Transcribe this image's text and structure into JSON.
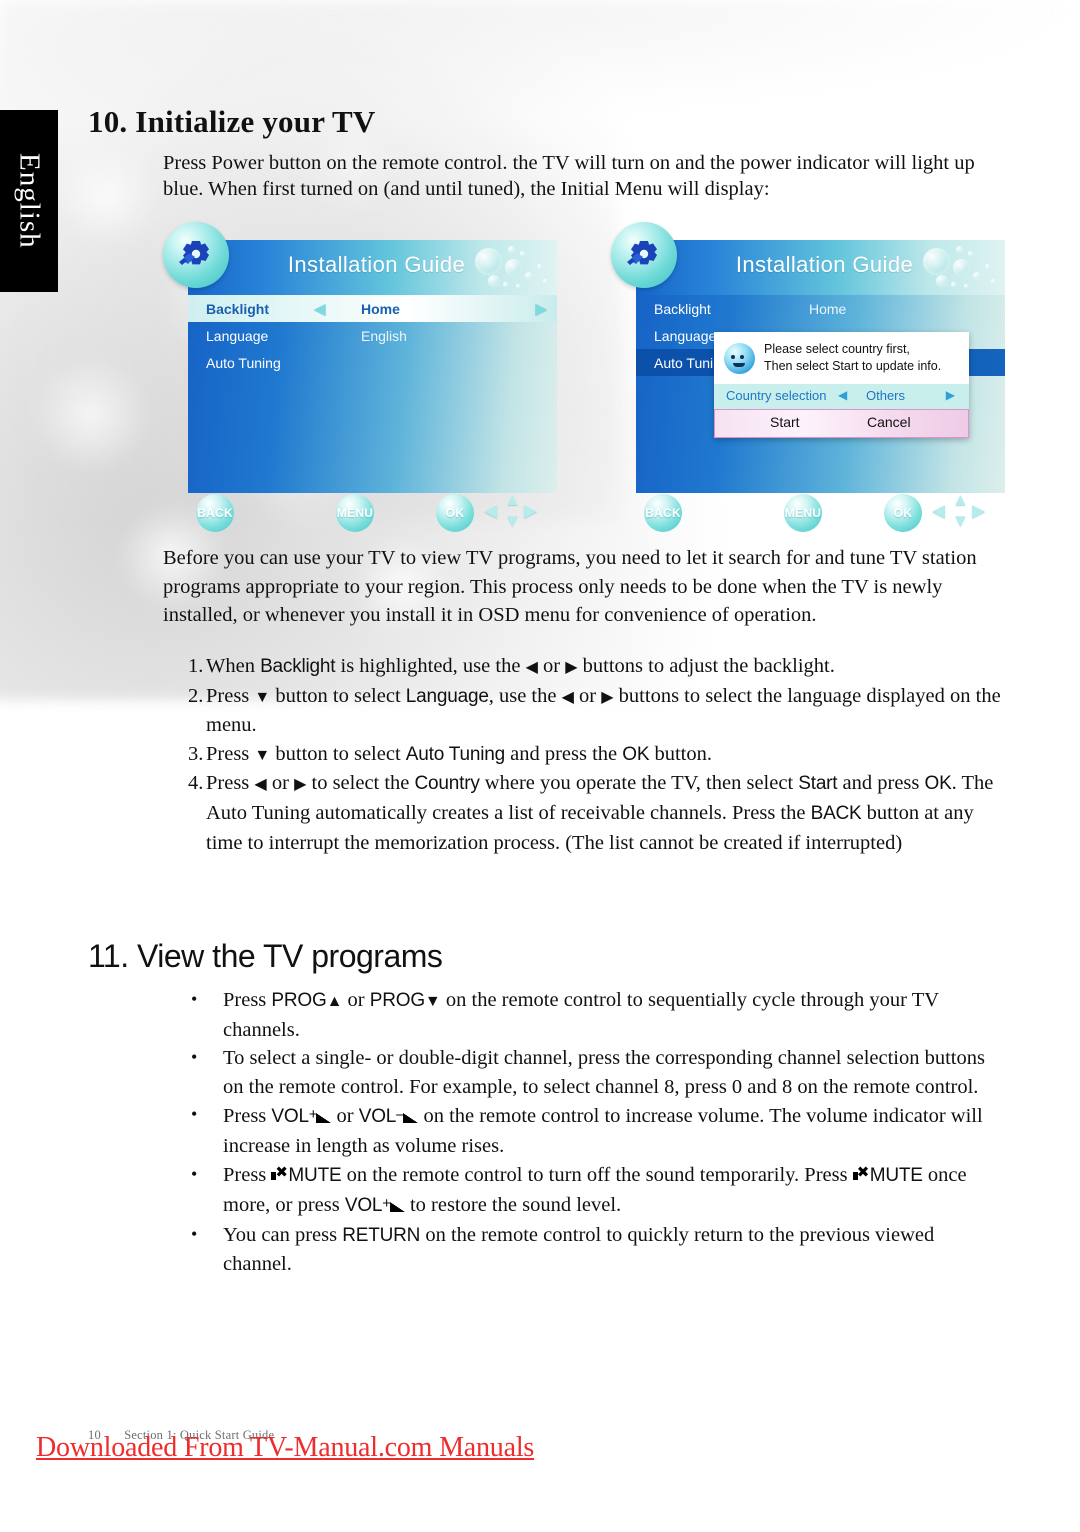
{
  "page": {
    "language_tab": "English",
    "background_note": "soft grey bokeh texture"
  },
  "section10": {
    "heading": "10. Initialize your TV",
    "intro": "Press Power button on the remote control. the TV will turn on and the power indicator will light up blue. When first turned on (and until tuned), the Initial Menu will display:",
    "paragraph": "Before you can use your TV to view TV programs, you need to let it search for and tune TV station programs appropriate to your region. This process only needs to be done when the TV is newly installed, or whenever you install it in OSD menu for convenience of operation.",
    "steps": [
      {
        "number": "1.",
        "parts": [
          {
            "t": "text",
            "v": "When "
          },
          {
            "t": "ui",
            "v": "Backlight"
          },
          {
            "t": "text",
            "v": " is highlighted, use the "
          },
          {
            "t": "glyph",
            "v": "◀"
          },
          {
            "t": "text",
            "v": " or "
          },
          {
            "t": "glyph",
            "v": "▶"
          },
          {
            "t": "text",
            "v": " buttons to adjust the backlight."
          }
        ]
      },
      {
        "number": "2.",
        "parts": [
          {
            "t": "text",
            "v": "Press "
          },
          {
            "t": "glyph",
            "v": "▼"
          },
          {
            "t": "text",
            "v": " button to select "
          },
          {
            "t": "ui",
            "v": "Language"
          },
          {
            "t": "text",
            "v": ", use the "
          },
          {
            "t": "glyph",
            "v": "◀"
          },
          {
            "t": "text",
            "v": " or "
          },
          {
            "t": "glyph",
            "v": "▶"
          },
          {
            "t": "text",
            "v": " buttons to select the language displayed on the menu."
          }
        ]
      },
      {
        "number": "3.",
        "parts": [
          {
            "t": "text",
            "v": "Press "
          },
          {
            "t": "glyph",
            "v": "▼"
          },
          {
            "t": "text",
            "v": " button to select "
          },
          {
            "t": "ui",
            "v": "Auto Tuning"
          },
          {
            "t": "text",
            "v": " and press the "
          },
          {
            "t": "ui",
            "v": "OK"
          },
          {
            "t": "text",
            "v": " button."
          }
        ]
      },
      {
        "number": "4.",
        "parts": [
          {
            "t": "text",
            "v": "Press "
          },
          {
            "t": "glyph",
            "v": "◀"
          },
          {
            "t": "text",
            "v": " or "
          },
          {
            "t": "glyph",
            "v": "▶"
          },
          {
            "t": "text",
            "v": " to select the "
          },
          {
            "t": "ui",
            "v": "Country"
          },
          {
            "t": "text",
            "v": " where you operate the TV, then select "
          },
          {
            "t": "ui",
            "v": "Start"
          },
          {
            "t": "text",
            "v": " and press "
          },
          {
            "t": "ui",
            "v": "OK"
          },
          {
            "t": "text",
            "v": ". The Auto Tuning automatically creates a list of receivable channels. Press the "
          },
          {
            "t": "ui",
            "v": "BACK"
          },
          {
            "t": "text",
            "v": " button at any time to interrupt the memorization process. (The list cannot be created if interrupted)"
          }
        ]
      }
    ]
  },
  "section11": {
    "heading": "11. View the TV programs",
    "bullets": [
      {
        "parts": [
          {
            "t": "text",
            "v": "Press "
          },
          {
            "t": "ui",
            "v": "PROG"
          },
          {
            "t": "glyph",
            "v": "▲"
          },
          {
            "t": "text",
            "v": " or "
          },
          {
            "t": "ui",
            "v": "PROG"
          },
          {
            "t": "glyph",
            "v": "▼"
          },
          {
            "t": "text",
            "v": " on the remote control to sequentially cycle through your TV channels."
          }
        ]
      },
      {
        "parts": [
          {
            "t": "text",
            "v": "To select a single- or double-digit channel, press the corresponding channel selection buttons on the remote control. For example, to select channel 8, press 0 and 8 on the remote control."
          }
        ]
      },
      {
        "parts": [
          {
            "t": "text",
            "v": "Press "
          },
          {
            "t": "ui",
            "v": "VOL"
          },
          {
            "t": "sup",
            "v": "+"
          },
          {
            "t": "ramp",
            "v": ""
          },
          {
            "t": "text",
            "v": " or "
          },
          {
            "t": "ui",
            "v": "VOL"
          },
          {
            "t": "sup",
            "v": "–"
          },
          {
            "t": "ramp",
            "v": ""
          },
          {
            "t": "text",
            "v": " on the remote control to increase volume. The volume indicator will increase in length as volume rises."
          }
        ]
      },
      {
        "parts": [
          {
            "t": "text",
            "v": "Press "
          },
          {
            "t": "mute",
            "v": ""
          },
          {
            "t": "ui",
            "v": "MUTE"
          },
          {
            "t": "text",
            "v": " on the remote control to turn off the sound temporarily. Press "
          },
          {
            "t": "mute",
            "v": ""
          },
          {
            "t": "ui",
            "v": "MUTE"
          },
          {
            "t": "text",
            "v": " once more, or press "
          },
          {
            "t": "ui",
            "v": "VOL"
          },
          {
            "t": "sup",
            "v": "+"
          },
          {
            "t": "ramp",
            "v": ""
          },
          {
            "t": "text",
            "v": " to restore the sound level."
          }
        ]
      },
      {
        "parts": [
          {
            "t": "text",
            "v": "You can press "
          },
          {
            "t": "ui",
            "v": "RETURN"
          },
          {
            "t": "text",
            "v": " on the remote control to quickly return to the previous viewed channel."
          }
        ]
      }
    ]
  },
  "tv_screens": [
    {
      "title": "Installation Guide",
      "gear_icon": "gear-icon",
      "menu": [
        {
          "label": "Backlight",
          "value": "Home",
          "state": "highlight",
          "left_arrow": "◀",
          "right_arrow": "▶"
        },
        {
          "label": "Language",
          "value": "English",
          "state": "normal"
        },
        {
          "label": "Auto Tuning",
          "value": "",
          "state": "normal"
        }
      ],
      "buttons": [
        {
          "label": "BACK"
        },
        {
          "label": "MENU"
        },
        {
          "label": "OK"
        }
      ],
      "dpad": {
        "up": "▲",
        "down": "▼",
        "left": "◀",
        "right": "▶"
      },
      "dialog": null
    },
    {
      "title": "Installation Guide",
      "gear_icon": "gear-icon",
      "menu": [
        {
          "label": "Backlight",
          "value": "Home",
          "state": "normal"
        },
        {
          "label": "Language",
          "value": "",
          "state": "normal"
        },
        {
          "label": "Auto Tuning",
          "value": "",
          "state": "highlight-dark"
        }
      ],
      "buttons": [
        {
          "label": "BACK"
        },
        {
          "label": "MENU"
        },
        {
          "label": "OK"
        }
      ],
      "dpad": {
        "up": "▲",
        "down": "▼",
        "left": "◀",
        "right": "▶"
      },
      "dialog": {
        "face_icon": "smiley-face-icon",
        "message_line1": "Please select country first,",
        "message_line2": "Then select Start to update info.",
        "country_label": "Country selection",
        "country_value": "Others",
        "left_arrow": "◀",
        "right_arrow": "▶",
        "start_label": "Start",
        "cancel_label": "Cancel"
      }
    }
  ],
  "footer": {
    "page_number": "10",
    "section_label": "Section 1: Quick Start Guide",
    "watermark": "Downloaded From TV-Manual.com Manuals"
  },
  "colors": {
    "tab_background": "#000000",
    "menu_blue": "#1663c6",
    "menu_pale": "#dcefec",
    "highlight_cyan": "#cfeff0",
    "highlight_dark_blue": "#0b4fa8",
    "dialog_country_bg": "#c9efec",
    "dialog_action_pink": "#f4dbee",
    "watermark_red": "#ef2b2b",
    "footer_grey": "#6f6f6f"
  }
}
